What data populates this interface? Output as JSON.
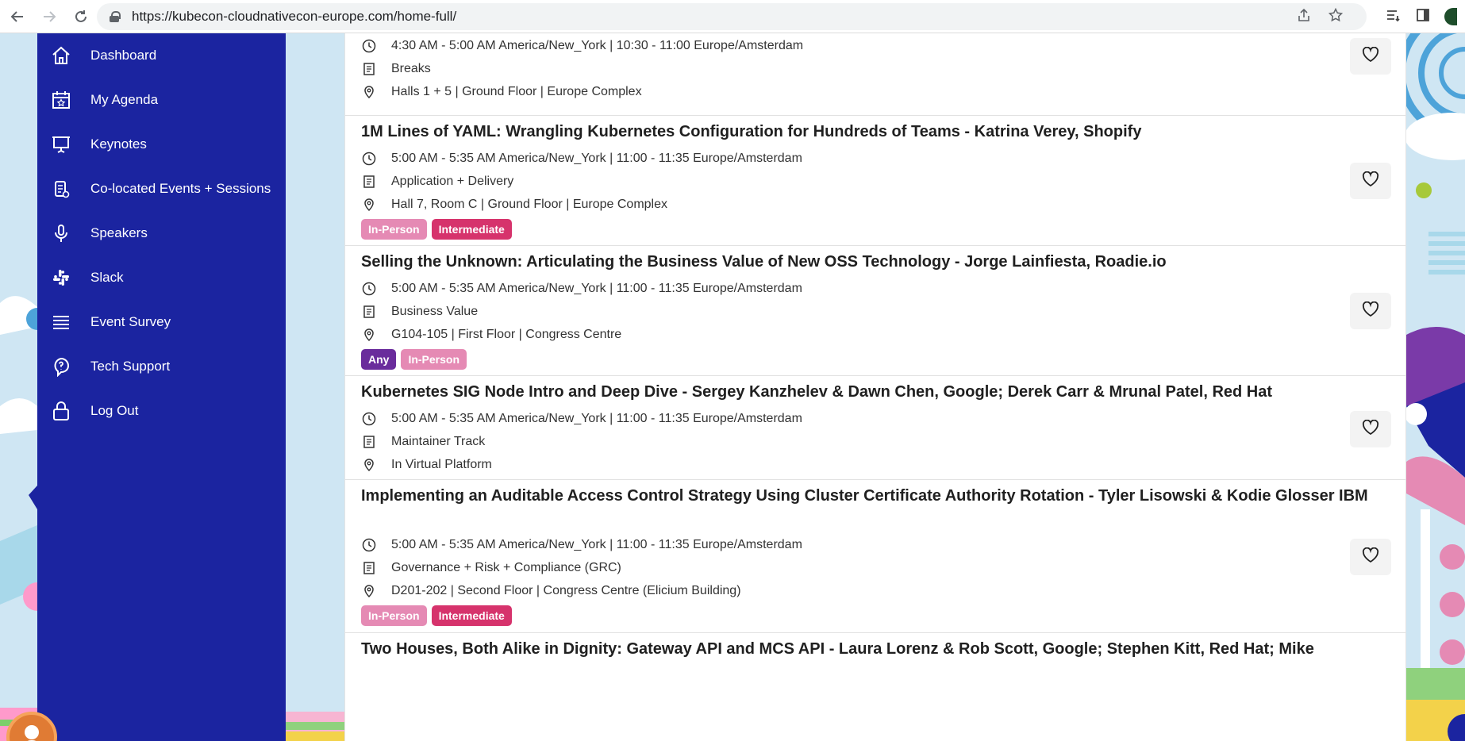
{
  "browser": {
    "url": "https://kubecon-cloudnativecon-europe.com/home-full/"
  },
  "colors": {
    "sidebar_bg": "#1b24a0",
    "tag_in_person": "#e58ab4",
    "tag_intermediate": "#d6336c",
    "tag_any": "#6a2c9c"
  },
  "sidebar": {
    "items": [
      {
        "label": "Dashboard",
        "icon": "home-icon"
      },
      {
        "label": "My Agenda",
        "icon": "calendar-star-icon"
      },
      {
        "label": "Keynotes",
        "icon": "presentation-icon"
      },
      {
        "label": "Co-located Events + Sessions",
        "icon": "document-list-icon"
      },
      {
        "label": "Speakers",
        "icon": "microphone-icon"
      },
      {
        "label": "Slack",
        "icon": "slack-icon"
      },
      {
        "label": "Event Survey",
        "icon": "menu-lines-icon"
      },
      {
        "label": "Tech Support",
        "icon": "support-chat-icon"
      },
      {
        "label": "Log Out",
        "icon": "lock-icon"
      }
    ]
  },
  "sessions": [
    {
      "title": "",
      "time": "4:30 AM - 5:00 AM America/New_York | 10:30 - 11:00 Europe/Amsterdam",
      "track": "Breaks",
      "location": "Halls 1 + 5 | Ground Floor | Europe Complex",
      "tags": []
    },
    {
      "title": "1M Lines of YAML: Wrangling Kubernetes Configuration for Hundreds of Teams - Katrina Verey, Shopify",
      "time": "5:00 AM - 5:35 AM America/New_York | 11:00 - 11:35 Europe/Amsterdam",
      "track": "Application + Delivery",
      "location": "Hall 7, Room C | Ground Floor | Europe Complex",
      "tags": [
        "In-Person",
        "Intermediate"
      ]
    },
    {
      "title": "Selling the Unknown: Articulating the Business Value of New OSS Technology - Jorge Lainfiesta, Roadie.io",
      "time": "5:00 AM - 5:35 AM America/New_York | 11:00 - 11:35 Europe/Amsterdam",
      "track": "Business Value",
      "location": "G104-105 | First Floor | Congress Centre",
      "tags": [
        "Any",
        "In-Person"
      ]
    },
    {
      "title": "Kubernetes SIG Node Intro and Deep Dive - Sergey Kanzhelev & Dawn Chen, Google; Derek Carr & Mrunal Patel, Red Hat",
      "time": "5:00 AM - 5:35 AM America/New_York | 11:00 - 11:35 Europe/Amsterdam",
      "track": "Maintainer Track",
      "location": "In Virtual Platform",
      "tags": []
    },
    {
      "title": "Implementing an Auditable Access Control Strategy Using Cluster Certificate Authority Rotation - Tyler Lisowski & Kodie Glosser IBM",
      "time": "5:00 AM - 5:35 AM America/New_York | 11:00 - 11:35 Europe/Amsterdam",
      "track": "Governance + Risk + Compliance (GRC)",
      "location": "D201-202 | Second Floor | Congress Centre (Elicium Building)",
      "tags": [
        "In-Person",
        "Intermediate"
      ]
    },
    {
      "title": "Two Houses, Both Alike in Dignity: Gateway API and MCS API - Laura Lorenz & Rob Scott, Google; Stephen Kitt, Red Hat; Mike"
    }
  ]
}
